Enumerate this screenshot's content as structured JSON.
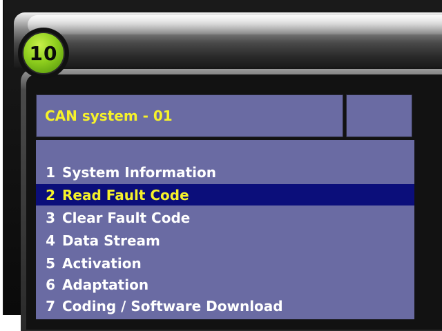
{
  "step_badge": {
    "number": "10"
  },
  "panel": {
    "title": "CAN system - 01",
    "title_aux": ""
  },
  "menu": {
    "selected_index": 1,
    "items": [
      {
        "number": "1",
        "label": "System Information"
      },
      {
        "number": "2",
        "label": "Read Fault Code"
      },
      {
        "number": "3",
        "label": "Clear Fault Code"
      },
      {
        "number": "4",
        "label": "Data Stream"
      },
      {
        "number": "5",
        "label": "Activation"
      },
      {
        "number": "6",
        "label": "Adaptation"
      },
      {
        "number": "7",
        "label": "Coding / Software Download"
      }
    ]
  },
  "colors": {
    "panel_bg": "#6a6ba3",
    "selected_bg": "#0b0e7a",
    "title_text": "#f6f22a",
    "selected_text": "#f6f22a",
    "menu_text": "#ffffff",
    "badge_green": "#8fcf1e"
  }
}
